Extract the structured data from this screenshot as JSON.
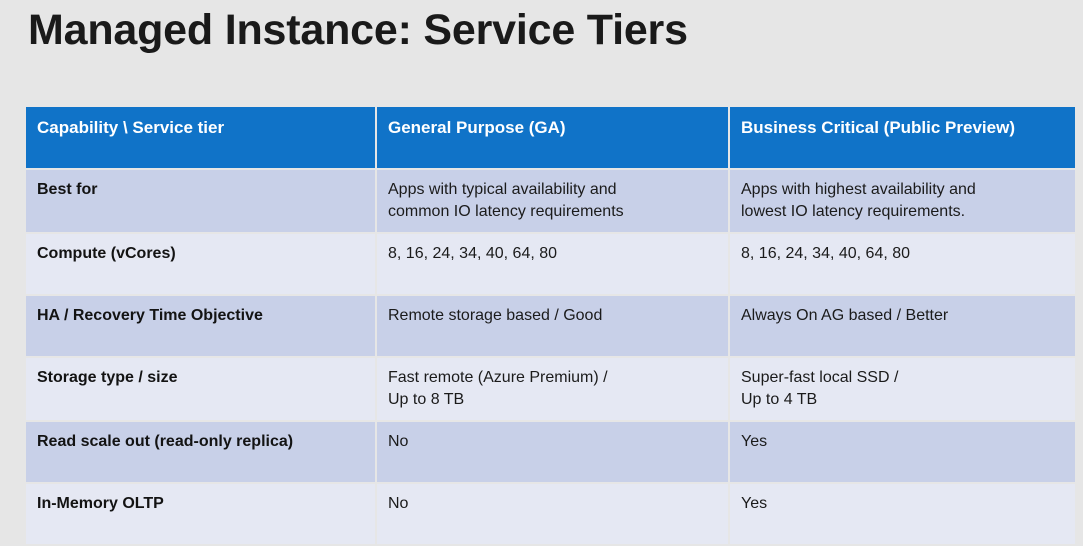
{
  "slide": {
    "title": "Managed Instance: Service Tiers",
    "background_color": "#e6e6e6",
    "header_color": "#1073c8",
    "row_dark_color": "#c8d0e8",
    "row_light_color": "#e5e8f3"
  },
  "table": {
    "headers": [
      "Capability \\ Service tier",
      "General Purpose (GA)",
      "Business Critical (Public Preview)"
    ],
    "rows": [
      {
        "label": "Best for",
        "general_purpose": [
          "Apps with typical availability and",
          "common IO latency requirements"
        ],
        "business_critical": [
          "Apps with highest availability and",
          "lowest IO latency requirements."
        ]
      },
      {
        "label": "Compute (vCores)",
        "general_purpose": [
          "8, 16, 24, 34, 40, 64, 80"
        ],
        "business_critical": [
          "8, 16, 24, 34, 40, 64, 80"
        ]
      },
      {
        "label": "HA / Recovery Time Objective",
        "general_purpose": [
          "Remote storage based / Good"
        ],
        "business_critical": [
          "Always On AG based / Better"
        ]
      },
      {
        "label": "Storage type / size",
        "general_purpose": [
          "Fast remote (Azure Premium) /",
          "Up to 8 TB"
        ],
        "business_critical": [
          "Super-fast local SSD /",
          "Up to 4 TB"
        ]
      },
      {
        "label": "Read scale out (read-only replica)",
        "general_purpose": [
          "No"
        ],
        "business_critical": [
          "Yes"
        ]
      },
      {
        "label": "In-Memory OLTP",
        "general_purpose": [
          "No"
        ],
        "business_critical": [
          "Yes"
        ]
      }
    ]
  }
}
